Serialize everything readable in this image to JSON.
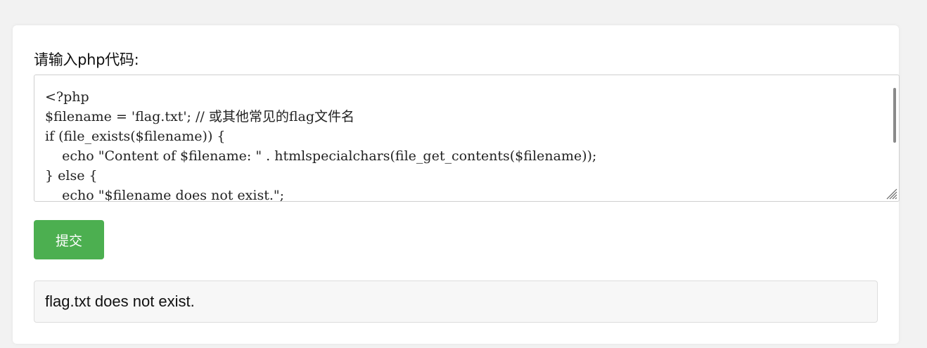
{
  "form": {
    "label": "请输入php代码:",
    "code_lines": [
      "<?php",
      "$filename = 'flag.txt'; // 或其他常见的flag文件名",
      "if (file_exists($filename)) {",
      "    echo \"Content of $filename: \" . htmlspecialchars(file_get_contents($filename));",
      "} else {",
      "    echo \"$filename does not exist.\";"
    ],
    "submit_label": "提交"
  },
  "result": {
    "text": "flag.txt does not exist."
  },
  "colors": {
    "submit_bg": "#4caf50",
    "page_bg": "#f2f2f2",
    "card_bg": "#ffffff",
    "result_bg": "#f7f7f7"
  }
}
